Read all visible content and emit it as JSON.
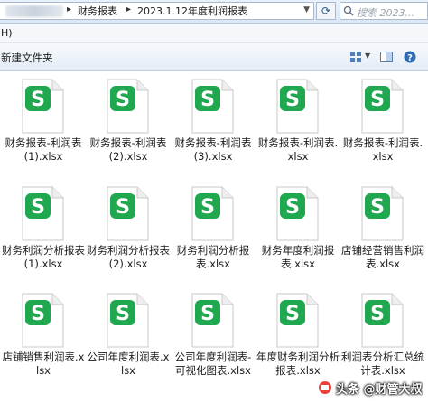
{
  "address": {
    "crumbs": [
      "财务报表",
      "2023.1.12年度利润报表"
    ],
    "separator": "▸",
    "refresh_icon": "refresh-icon",
    "search_placeholder": "搜索 2023..."
  },
  "menu": {
    "label": "H)"
  },
  "toolbar": {
    "new_folder_label": "新建文件夹"
  },
  "colors": {
    "icon_green": "#1fa84f",
    "icon_bg": "#ffffff",
    "accent": "#2d6ab4"
  },
  "files": [
    {
      "name": "财务报表-利润表 (1).xlsx"
    },
    {
      "name": "财务报表-利润表 (2).xlsx"
    },
    {
      "name": "财务报表-利润表 (3).xlsx"
    },
    {
      "name": "财务报表-利润表.xlsx"
    },
    {
      "name": "财务报表-利润表.xlsx"
    },
    {
      "name": "财务利润分析报表 (1).xlsx"
    },
    {
      "name": "财务利润分析报表 (2).xlsx"
    },
    {
      "name": "财务利润分析报表.xlsx"
    },
    {
      "name": "财务年度利润报表.xlsx"
    },
    {
      "name": "店铺经营销售利润表.xlsx"
    },
    {
      "name": "店铺销售利润表.xlsx"
    },
    {
      "name": "公司年度利润表.xlsx"
    },
    {
      "name": "公司年度利润表-可视化图表.xlsx"
    },
    {
      "name": "年度财务利润分析报表.xlsx"
    },
    {
      "name": "利润表分析汇总统计表.xlsx"
    }
  ],
  "watermark": {
    "text": "头条 @财管大叔"
  }
}
